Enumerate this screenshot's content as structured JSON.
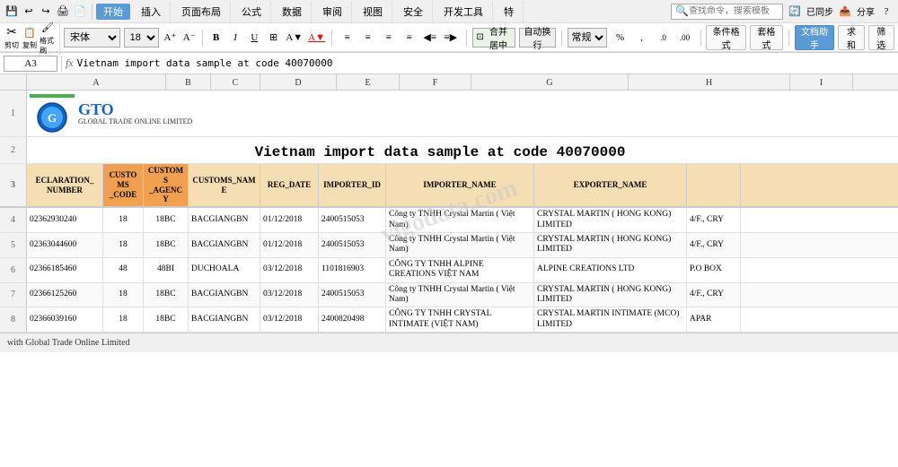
{
  "window": {
    "title": "Vietnam import data sample at code 40070000"
  },
  "toolbar": {
    "start_label": "开始",
    "insert_label": "插入",
    "layout_label": "页面布局",
    "formula_label": "公式",
    "data_label": "数据",
    "review_label": "审阅",
    "view_label": "视图",
    "security_label": "安全",
    "dev_label": "开发工具",
    "special_label": "特",
    "find_cmd_label": "查找命令，搜索模板",
    "sync_label": "已同步",
    "share_label": "分享"
  },
  "font_toolbar": {
    "font_name": "宋体",
    "font_size": "18",
    "bold": "B",
    "italic": "I",
    "underline": "U",
    "merge_label": "合并居中",
    "auto_wrap_label": "自动换行",
    "num_format": "常规",
    "pct_label": "%",
    "comma_label": ",",
    "dec_up": ".0",
    "dec_down": ".00",
    "cond_fmt_label": "条件格式",
    "tbl_fmt_label": "套格式",
    "doc_assist_label": "文档助手",
    "sum_label": "求和",
    "filter_label": "筛选"
  },
  "formula_bar": {
    "cell_ref": "A3",
    "formula": "Vietnam import data sample at code 40070000"
  },
  "columns": [
    "A",
    "B",
    "C",
    "D",
    "E",
    "F",
    "G",
    "H"
  ],
  "logo": {
    "circle_text": "G",
    "brand": "GTO",
    "subtitle": "GLOBAL TRADE ONLINE LIMITED"
  },
  "sheet_title": "Vietnam import data sample at code 40070000",
  "table_headers": [
    {
      "id": "decl",
      "label": "ECLARATION_\nNUMBER",
      "class": "w-decl"
    },
    {
      "id": "ccode",
      "label": "CUSTOMS\n_CODE",
      "class": "w-ccode",
      "highlight": true
    },
    {
      "id": "cagency",
      "label": "CUSTOMS\n_AGENCY",
      "class": "w-cagency",
      "highlight": true
    },
    {
      "id": "cname",
      "label": "CUSTOMS_NAME",
      "class": "w-cname"
    },
    {
      "id": "regdate",
      "label": "REG_DATE",
      "class": "w-regdate"
    },
    {
      "id": "impid",
      "label": "IMPORTER_ID",
      "class": "w-impid"
    },
    {
      "id": "impname",
      "label": "IMPORTER_NAME",
      "class": "w-impname"
    },
    {
      "id": "expname",
      "label": "EXPORTER_NAME",
      "class": "w-expname"
    },
    {
      "id": "extra",
      "label": "",
      "class": "w-extra"
    }
  ],
  "table_rows": [
    {
      "decl": "02362930240",
      "ccode": "18",
      "cagency": "18BC",
      "cname": "BACGIANGBN",
      "regdate": "01/12/2018",
      "impid": "2400515053",
      "impname": "Công ty TNHH Crystal Martin ( Việt Nam)",
      "expname": "CRYSTAL MARTIN ( HONG KONG) LIMITED",
      "extra": "4/F., CRY"
    },
    {
      "decl": "02363044600",
      "ccode": "18",
      "cagency": "18BC",
      "cname": "BACGIANGBN",
      "regdate": "01/12/2018",
      "impid": "2400515053",
      "impname": "Công ty TNHH Crystal Martin ( Việt Nam)",
      "expname": "CRYSTAL MARTIN ( HONG KONG) LIMITED",
      "extra": "4/F., CRY"
    },
    {
      "decl": "02366185460",
      "ccode": "48",
      "cagency": "48BI",
      "cname": "DUCHOALA",
      "regdate": "03/12/2018",
      "impid": "1101816903",
      "impname": "CÔNG TY TNHH ALPINE CREATIONS VIỆT NAM",
      "expname": "ALPINE CREATIONS  LTD",
      "extra": "P.O BOX"
    },
    {
      "decl": "02366125260",
      "ccode": "18",
      "cagency": "18BC",
      "cname": "BACGIANGBN",
      "regdate": "03/12/2018",
      "impid": "2400515053",
      "impname": "Công ty TNHH Crystal Martin ( Việt Nam)",
      "expname": "CRYSTAL MARTIN ( HONG KONG) LIMITED",
      "extra": "4/F., CRY"
    },
    {
      "decl": "02366039160",
      "ccode": "18",
      "cagency": "18BC",
      "cname": "BACGIANGBN",
      "regdate": "03/12/2018",
      "impid": "2400820498",
      "impname": "CÔNG TY TNHH CRYSTAL INTIMATE (VIỆT NAM)",
      "expname": "CRYSTAL MARTIN INTIMATE (MCO) LIMITED",
      "extra": "APAR"
    }
  ],
  "watermark": "vigodata.com",
  "status_bar": {
    "text": "with Global Trade Online Limited"
  }
}
